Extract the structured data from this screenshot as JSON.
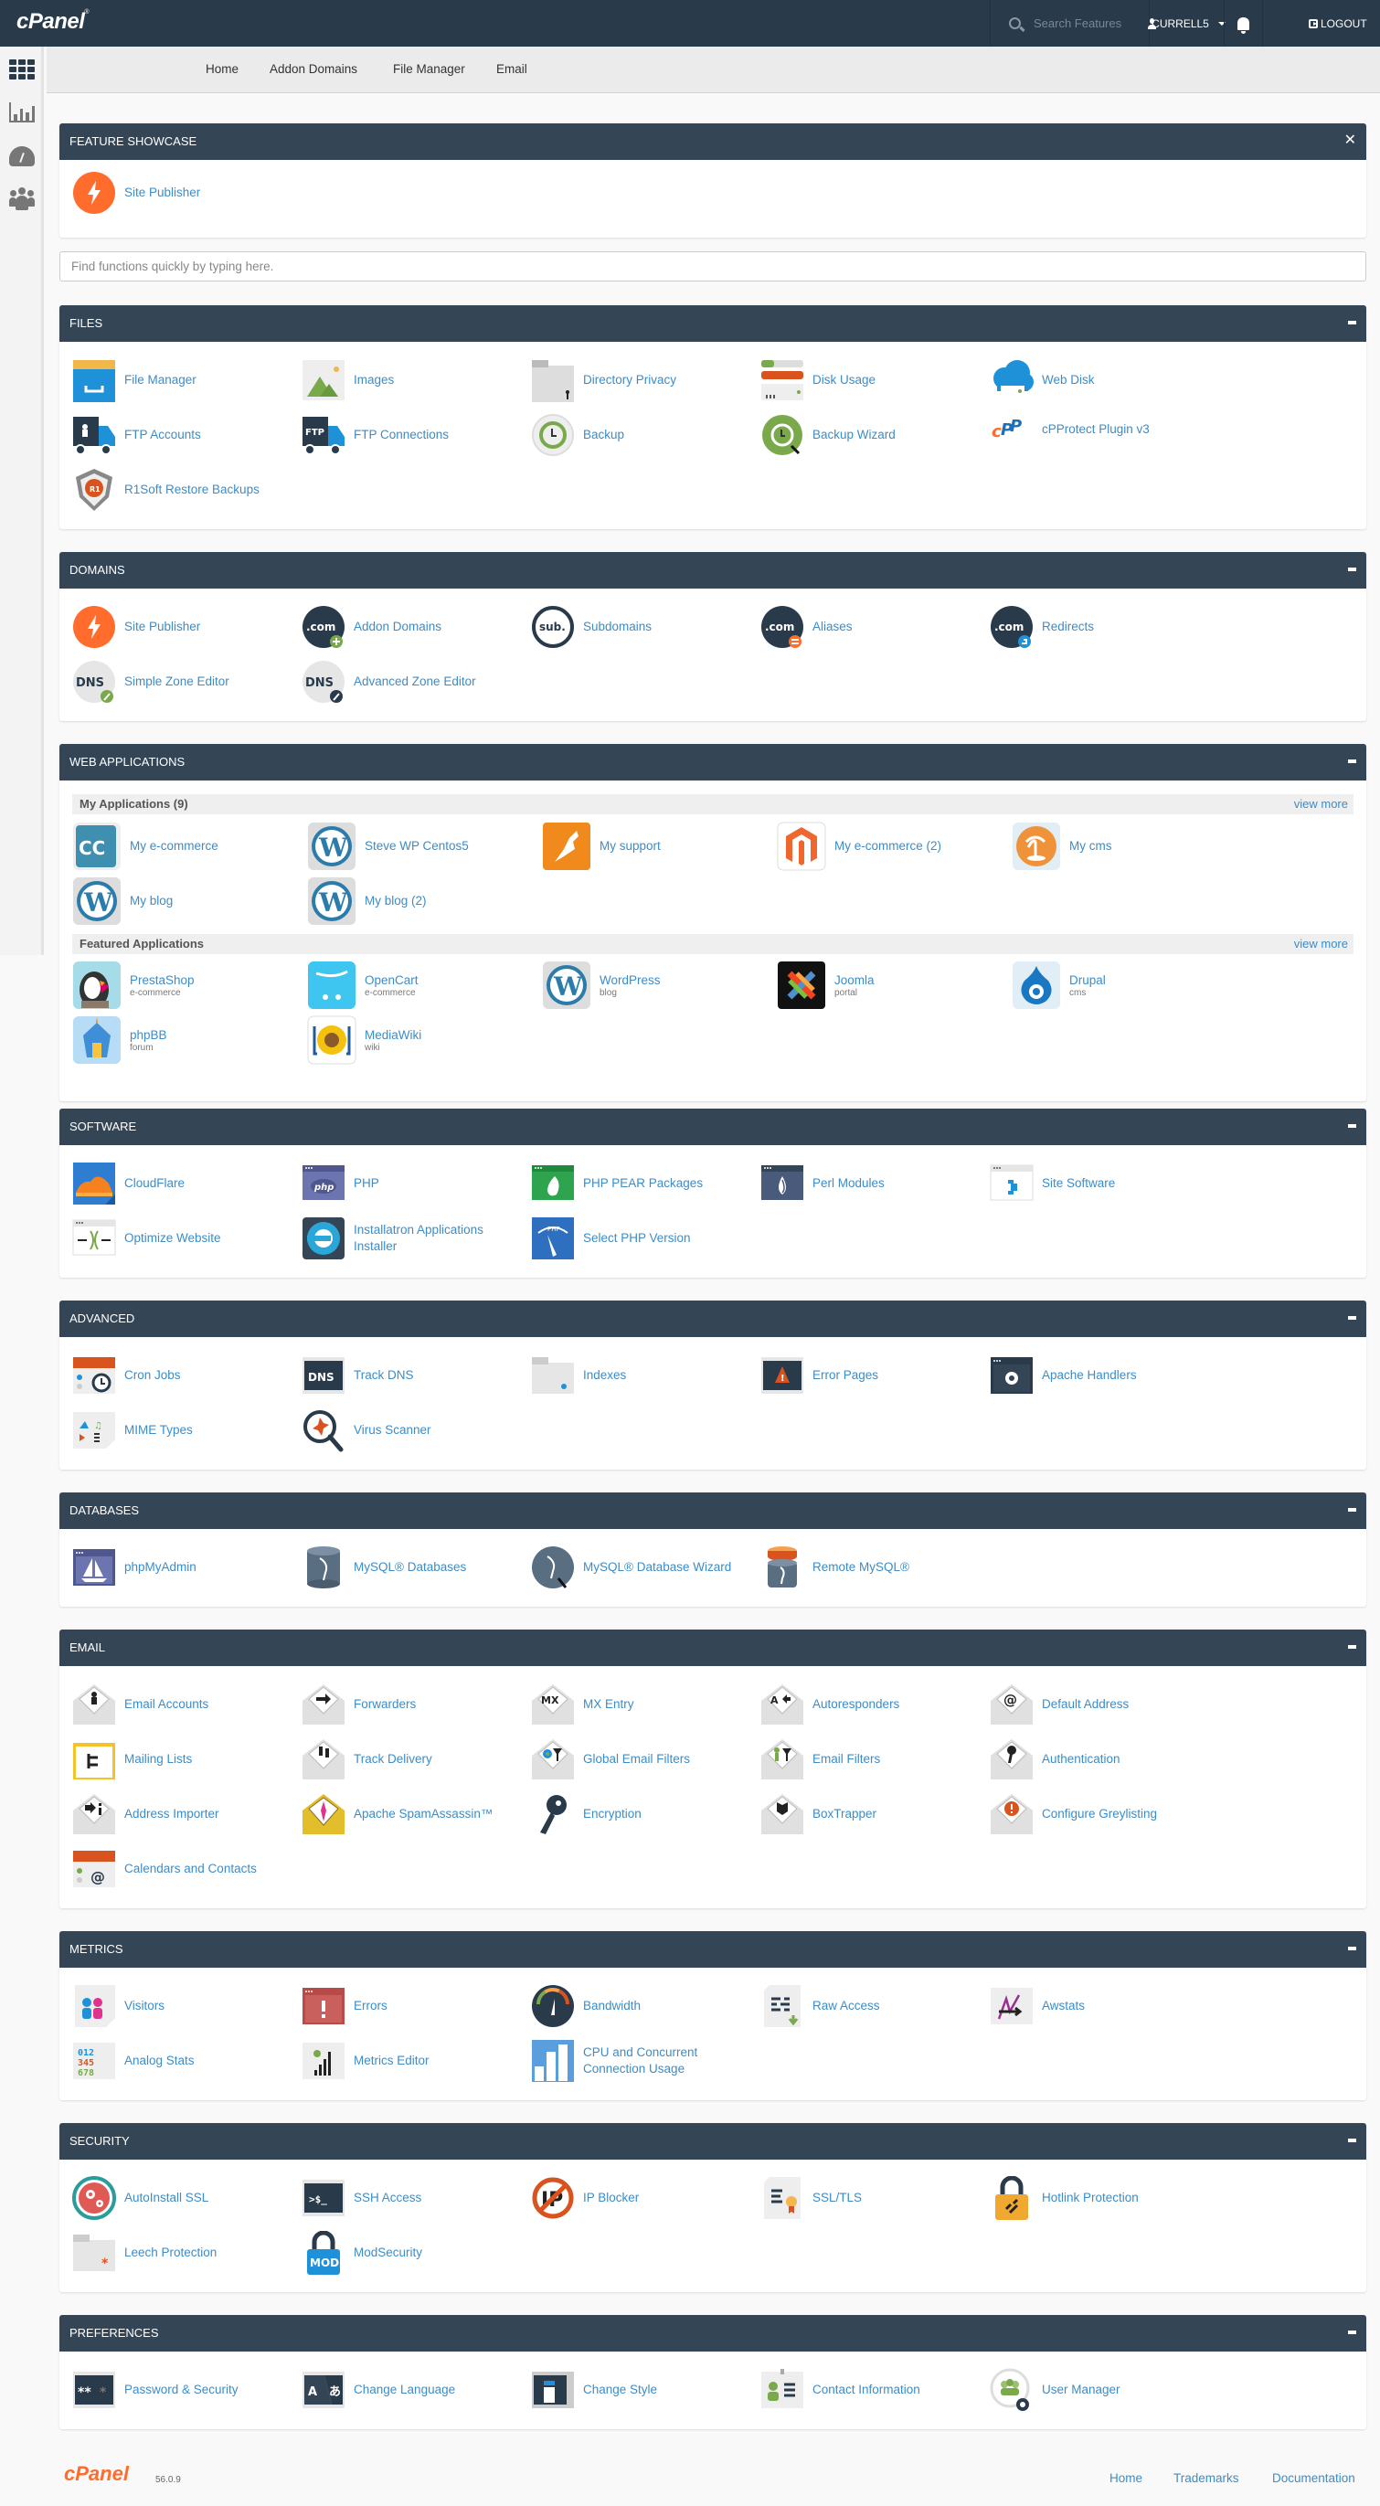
{
  "brand": {
    "logo_text": "cPanel",
    "version": "56.0.9"
  },
  "topbar": {
    "search_placeholder": "Search Features",
    "username": "CURRELL5",
    "logout_label": "LOGOUT"
  },
  "sidebar": {
    "items": [
      {
        "name": "home",
        "icon": "grid-icon"
      },
      {
        "name": "statistics",
        "icon": "bar-chart-icon"
      },
      {
        "name": "dashboard",
        "icon": "gauge-icon"
      },
      {
        "name": "user-manager",
        "icon": "users-icon"
      }
    ]
  },
  "breadcrumb": [
    "Home",
    "Addon Domains",
    "File Manager",
    "Email"
  ],
  "quick_find": {
    "placeholder": "Find functions quickly by typing here.",
    "value": ""
  },
  "feature_showcase": {
    "title": "FEATURE SHOWCASE",
    "items": [
      {
        "label": "Site Publisher",
        "icon": "site-publisher-icon"
      }
    ]
  },
  "sections": {
    "files": {
      "title": "FILES",
      "items": [
        {
          "label": "File Manager",
          "icon": "file-manager-icon"
        },
        {
          "label": "Images",
          "icon": "images-icon"
        },
        {
          "label": "Directory Privacy",
          "icon": "directory-privacy-icon"
        },
        {
          "label": "Disk Usage",
          "icon": "disk-usage-icon"
        },
        {
          "label": "Web Disk",
          "icon": "web-disk-icon"
        },
        {
          "label": "FTP Accounts",
          "icon": "ftp-accounts-icon"
        },
        {
          "label": "FTP Connections",
          "icon": "ftp-connections-icon"
        },
        {
          "label": "Backup",
          "icon": "backup-icon"
        },
        {
          "label": "Backup Wizard",
          "icon": "backup-wizard-icon"
        },
        {
          "label": "cPProtect Plugin v3",
          "icon": "cpprotect-icon"
        },
        {
          "label": "R1Soft Restore Backups",
          "icon": "r1soft-icon"
        }
      ]
    },
    "domains": {
      "title": "DOMAINS",
      "items": [
        {
          "label": "Site Publisher",
          "icon": "site-publisher-icon"
        },
        {
          "label": "Addon Domains",
          "icon": "addon-domains-icon"
        },
        {
          "label": "Subdomains",
          "icon": "subdomains-icon"
        },
        {
          "label": "Aliases",
          "icon": "aliases-icon"
        },
        {
          "label": "Redirects",
          "icon": "redirects-icon"
        },
        {
          "label": "Simple Zone Editor",
          "icon": "simple-zone-editor-icon"
        },
        {
          "label": "Advanced Zone Editor",
          "icon": "advanced-zone-editor-icon"
        }
      ]
    },
    "web_applications": {
      "title": "WEB APPLICATIONS",
      "my_apps_title": "My Applications (9)",
      "featured_title": "Featured Applications",
      "view_more": "view more",
      "my_apps": [
        {
          "label": "My e-commerce",
          "icon": "cubecart-icon"
        },
        {
          "label": "Steve WP Centos5",
          "icon": "wordpress-icon"
        },
        {
          "label": "My support",
          "icon": "kangaroo-icon"
        },
        {
          "label": "My e-commerce (2)",
          "icon": "magento-icon"
        },
        {
          "label": "My cms",
          "icon": "palm-cms-icon"
        },
        {
          "label": "My blog",
          "icon": "wordpress-icon"
        },
        {
          "label": "My blog (2)",
          "icon": "wordpress-icon"
        }
      ],
      "featured": [
        {
          "label": "PrestaShop",
          "category": "e-commerce",
          "icon": "prestashop-icon"
        },
        {
          "label": "OpenCart",
          "category": "e-commerce",
          "icon": "opencart-icon"
        },
        {
          "label": "WordPress",
          "category": "blog",
          "icon": "wordpress-icon"
        },
        {
          "label": "Joomla",
          "category": "portal",
          "icon": "joomla-icon"
        },
        {
          "label": "Drupal",
          "category": "cms",
          "icon": "drupal-icon"
        },
        {
          "label": "phpBB",
          "category": "forum",
          "icon": "phpbb-icon"
        },
        {
          "label": "MediaWiki",
          "category": "wiki",
          "icon": "mediawiki-icon"
        }
      ]
    },
    "software": {
      "title": "SOFTWARE",
      "items": [
        {
          "label": "CloudFlare",
          "icon": "cloudflare-icon"
        },
        {
          "label": "PHP",
          "icon": "php-icon"
        },
        {
          "label": "PHP PEAR Packages",
          "icon": "php-pear-icon"
        },
        {
          "label": "Perl Modules",
          "icon": "perl-modules-icon"
        },
        {
          "label": "Site Software",
          "icon": "site-software-icon"
        },
        {
          "label": "Optimize Website",
          "icon": "optimize-website-icon"
        },
        {
          "label": "Installatron Applications Installer",
          "icon": "installatron-icon"
        },
        {
          "label": "Select PHP Version",
          "icon": "select-php-version-icon"
        }
      ]
    },
    "advanced": {
      "title": "ADVANCED",
      "items": [
        {
          "label": "Cron Jobs",
          "icon": "cron-jobs-icon"
        },
        {
          "label": "Track DNS",
          "icon": "track-dns-icon"
        },
        {
          "label": "Indexes",
          "icon": "indexes-icon"
        },
        {
          "label": "Error Pages",
          "icon": "error-pages-icon"
        },
        {
          "label": "Apache Handlers",
          "icon": "apache-handlers-icon"
        },
        {
          "label": "MIME Types",
          "icon": "mime-types-icon"
        },
        {
          "label": "Virus Scanner",
          "icon": "virus-scanner-icon"
        }
      ]
    },
    "databases": {
      "title": "DATABASES",
      "items": [
        {
          "label": "phpMyAdmin",
          "icon": "phpmyadmin-icon"
        },
        {
          "label": "MySQL® Databases",
          "icon": "mysql-databases-icon"
        },
        {
          "label": "MySQL® Database Wizard",
          "icon": "mysql-wizard-icon"
        },
        {
          "label": "Remote MySQL®",
          "icon": "remote-mysql-icon"
        }
      ]
    },
    "email": {
      "title": "EMAIL",
      "items": [
        {
          "label": "Email Accounts",
          "icon": "email-accounts-icon"
        },
        {
          "label": "Forwarders",
          "icon": "forwarders-icon"
        },
        {
          "label": "MX Entry",
          "icon": "mx-entry-icon"
        },
        {
          "label": "Autoresponders",
          "icon": "autoresponders-icon"
        },
        {
          "label": "Default Address",
          "icon": "default-address-icon"
        },
        {
          "label": "Mailing Lists",
          "icon": "mailing-lists-icon"
        },
        {
          "label": "Track Delivery",
          "icon": "track-delivery-icon"
        },
        {
          "label": "Global Email Filters",
          "icon": "global-email-filters-icon"
        },
        {
          "label": "Email Filters",
          "icon": "email-filters-icon"
        },
        {
          "label": "Authentication",
          "icon": "authentication-icon"
        },
        {
          "label": "Address Importer",
          "icon": "address-importer-icon"
        },
        {
          "label": "Apache SpamAssassin™",
          "icon": "spamassassin-icon"
        },
        {
          "label": "Encryption",
          "icon": "encryption-key-icon"
        },
        {
          "label": "BoxTrapper",
          "icon": "boxtrapper-icon"
        },
        {
          "label": "Configure Greylisting",
          "icon": "greylisting-icon"
        },
        {
          "label": "Calendars and Contacts",
          "icon": "calendars-contacts-icon"
        }
      ]
    },
    "metrics": {
      "title": "METRICS",
      "items": [
        {
          "label": "Visitors",
          "icon": "visitors-icon"
        },
        {
          "label": "Errors",
          "icon": "errors-icon"
        },
        {
          "label": "Bandwidth",
          "icon": "bandwidth-icon"
        },
        {
          "label": "Raw Access",
          "icon": "raw-access-icon"
        },
        {
          "label": "Awstats",
          "icon": "awstats-icon"
        },
        {
          "label": "Analog Stats",
          "icon": "analog-stats-icon"
        },
        {
          "label": "Metrics Editor",
          "icon": "metrics-editor-icon"
        },
        {
          "label": "CPU and Concurrent Connection Usage",
          "icon": "cpu-usage-icon"
        }
      ]
    },
    "security": {
      "title": "SECURITY",
      "items": [
        {
          "label": "AutoInstall SSL",
          "icon": "autoinstall-ssl-icon"
        },
        {
          "label": "SSH Access",
          "icon": "ssh-access-icon"
        },
        {
          "label": "IP Blocker",
          "icon": "ip-blocker-icon"
        },
        {
          "label": "SSL/TLS",
          "icon": "ssl-tls-icon"
        },
        {
          "label": "Hotlink Protection",
          "icon": "hotlink-protection-icon"
        },
        {
          "label": "Leech Protection",
          "icon": "leech-protection-icon"
        },
        {
          "label": "ModSecurity",
          "icon": "modsecurity-icon"
        }
      ]
    },
    "preferences": {
      "title": "PREFERENCES",
      "items": [
        {
          "label": "Password & Security",
          "icon": "password-security-icon"
        },
        {
          "label": "Change Language",
          "icon": "change-language-icon"
        },
        {
          "label": "Change Style",
          "icon": "change-style-icon"
        },
        {
          "label": "Contact Information",
          "icon": "contact-information-icon"
        },
        {
          "label": "User Manager",
          "icon": "user-manager-icon"
        }
      ]
    }
  },
  "footer": {
    "links": [
      "Home",
      "Trademarks",
      "Documentation"
    ]
  },
  "colors": {
    "header_bg": "#293a4a",
    "panel_header_bg": "#344556",
    "link": "#3d8cc7",
    "brand_orange": "#ff6c2c"
  }
}
